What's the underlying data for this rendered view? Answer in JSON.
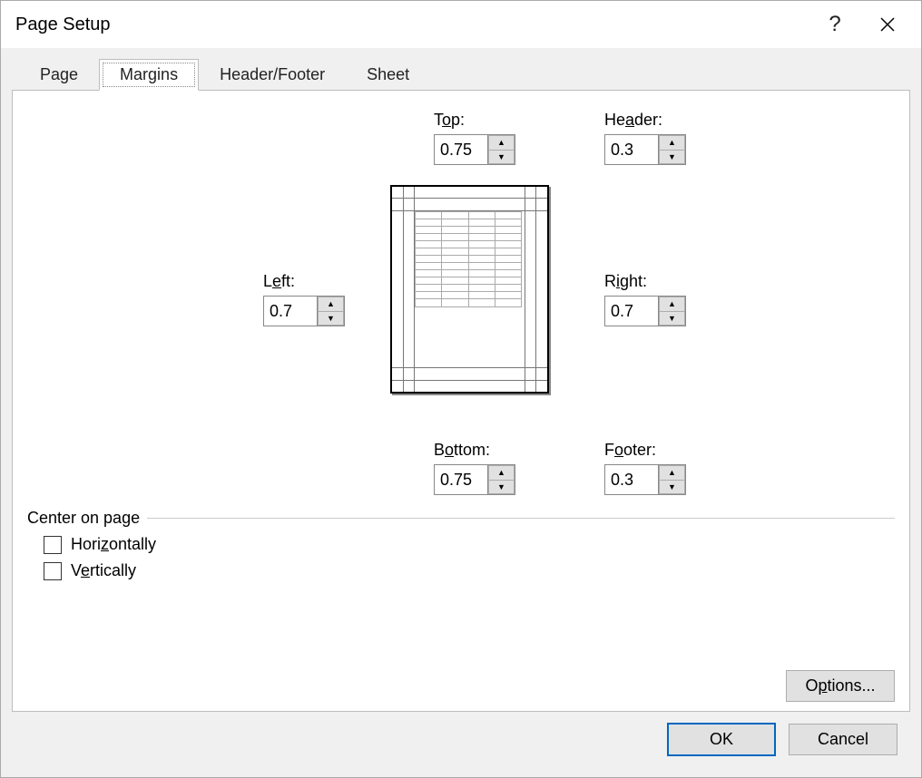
{
  "title": "Page Setup",
  "tabs": [
    "Page",
    "Margins",
    "Header/Footer",
    "Sheet"
  ],
  "activeTab": 1,
  "margins": {
    "top": {
      "label_pre": "T",
      "label_ul": "o",
      "label_post": "p:",
      "value": "0.75"
    },
    "header": {
      "label_pre": "He",
      "label_ul": "a",
      "label_post": "der:",
      "value": "0.3"
    },
    "left": {
      "label_pre": "L",
      "label_ul": "e",
      "label_post": "ft:",
      "value": "0.7"
    },
    "right": {
      "label_pre": "R",
      "label_ul": "i",
      "label_post": "ght:",
      "value": "0.7"
    },
    "bottom": {
      "label_pre": "B",
      "label_ul": "o",
      "label_post": "ttom:",
      "value": "0.75"
    },
    "footer": {
      "label_pre": "F",
      "label_ul": "o",
      "label_post": "oter:",
      "value": "0.3"
    }
  },
  "centerOnPage": {
    "title": "Center on page",
    "horizontally": {
      "pre": "Hori",
      "ul": "z",
      "post": "ontally",
      "checked": false
    },
    "vertically": {
      "pre": "V",
      "ul": "e",
      "post": "rtically",
      "checked": false
    }
  },
  "buttons": {
    "options": {
      "pre": "O",
      "ul": "p",
      "post": "tions..."
    },
    "ok": "OK",
    "cancel": "Cancel"
  }
}
